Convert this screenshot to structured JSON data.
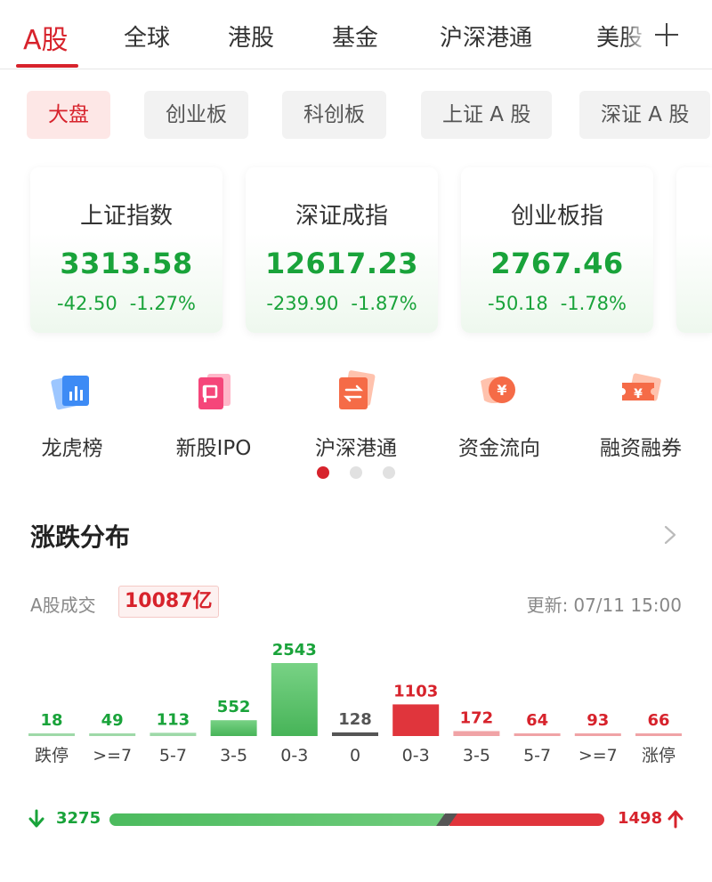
{
  "top_tabs": [
    {
      "label": "A股",
      "active": true
    },
    {
      "label": "全球",
      "active": false
    },
    {
      "label": "港股",
      "active": false
    },
    {
      "label": "基金",
      "active": false
    },
    {
      "label": "沪深港通",
      "active": false
    },
    {
      "label": "美股",
      "active": false
    }
  ],
  "top_add_icon": "plus-icon",
  "sub_tabs": [
    {
      "label": "大盘",
      "active": true
    },
    {
      "label": "创业板",
      "active": false
    },
    {
      "label": "科创板",
      "active": false
    },
    {
      "label": "上证 A 股",
      "active": false
    },
    {
      "label": "深证 A 股",
      "active": false
    }
  ],
  "indices": [
    {
      "name": "上证指数",
      "value": "3313.58",
      "change": "-42.50",
      "change_pct": "-1.27%"
    },
    {
      "name": "深证成指",
      "value": "12617.23",
      "change": "-239.90",
      "change_pct": "-1.87%"
    },
    {
      "name": "创业板指",
      "value": "2767.46",
      "change": "-50.18",
      "change_pct": "-1.78%"
    }
  ],
  "quick_entries": [
    {
      "label": "龙虎榜",
      "icon": "dragon-tiger-list-icon"
    },
    {
      "label": "新股IPO",
      "icon": "new-ipo-icon"
    },
    {
      "label": "沪深港通",
      "icon": "stock-connect-icon"
    },
    {
      "label": "资金流向",
      "icon": "capital-flow-icon"
    },
    {
      "label": "融资融券",
      "icon": "margin-trading-icon"
    }
  ],
  "carousel_pages": 3,
  "carousel_active_page": 1,
  "section": {
    "title": "涨跌分布",
    "volume_label": "A股成交",
    "volume_value": "10087亿",
    "update_label": "更新:",
    "update_time": "07/11 15:00"
  },
  "colors": {
    "up": "#d7232c",
    "down": "#19a33a",
    "flat": "#555555"
  },
  "chart_data": {
    "type": "bar",
    "categories": [
      "跌停",
      ">=7",
      "5-7",
      "3-5",
      "0-3",
      "0",
      "0-3",
      "3-5",
      "5-7",
      ">=7",
      "涨停"
    ],
    "values": [
      18,
      49,
      113,
      552,
      2543,
      128,
      1103,
      172,
      64,
      93,
      66
    ],
    "groups": [
      "down",
      "down",
      "down",
      "down",
      "down",
      "flat",
      "up",
      "up",
      "up",
      "up",
      "up"
    ]
  },
  "ratio": {
    "down_count": 3275,
    "up_count": 1498,
    "down_icon": "down-arrow-icon",
    "up_icon": "up-arrow-icon"
  }
}
